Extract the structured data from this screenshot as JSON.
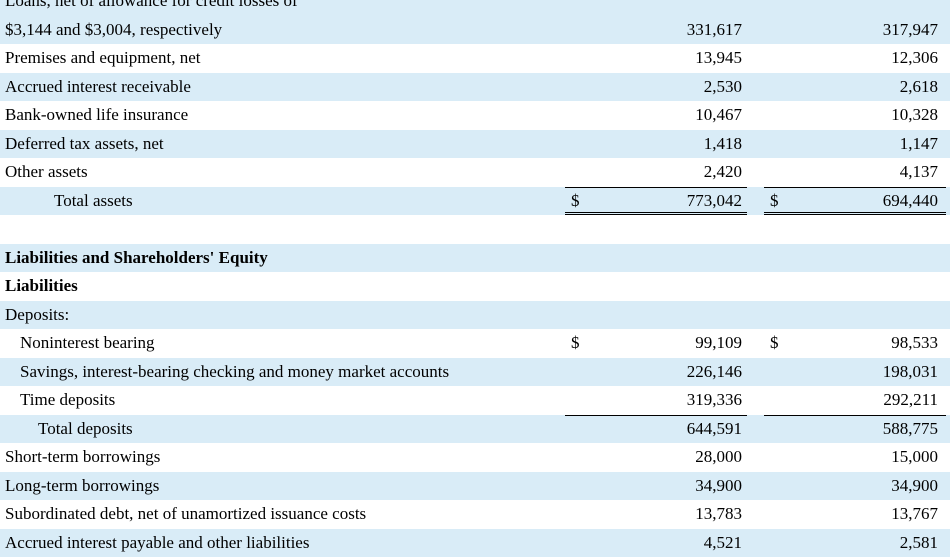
{
  "assets": {
    "loans_label_line1": "Loans, net of allowance for credit losses of",
    "loans_label_line2": "$3,144 and $3,004, respectively",
    "rows": [
      {
        "label": "Premises and equipment, net",
        "v1": "13,945",
        "v2": "12,306"
      },
      {
        "label": "Accrued interest receivable",
        "v1": "2,530",
        "v2": "2,618"
      },
      {
        "label": "Bank-owned life insurance",
        "v1": "10,467",
        "v2": "10,328"
      },
      {
        "label": "Deferred tax assets, net",
        "v1": "1,418",
        "v2": "1,147"
      },
      {
        "label": "Other assets",
        "v1": "2,420",
        "v2": "4,137"
      }
    ],
    "loans_v1": "331,617",
    "loans_v2": "317,947",
    "total_label": "Total assets",
    "total_cur": "$",
    "total_v1": "773,042",
    "total_v2": "694,440"
  },
  "liabilities": {
    "section_title": "Liabilities and Shareholders' Equity",
    "subtitle": "Liabilities",
    "deposits_label": "Deposits:",
    "noninterest_label": "Noninterest bearing",
    "noninterest_cur": "$",
    "noninterest_v1": "99,109",
    "noninterest_v2": "98,533",
    "savings_label": "Savings, interest-bearing checking and money market accounts",
    "savings_v1": "226,146",
    "savings_v2": "198,031",
    "time_label": "Time deposits",
    "time_v1": "319,336",
    "time_v2": "292,211",
    "total_deposits_label": "Total deposits",
    "total_deposits_v1": "644,591",
    "total_deposits_v2": "588,775",
    "short_label": "Short-term borrowings",
    "short_v1": "28,000",
    "short_v2": "15,000",
    "long_label": "Long-term borrowings",
    "long_v1": "34,900",
    "long_v2": "34,900",
    "sub_label": "Subordinated debt, net of unamortized issuance costs",
    "sub_v1": "13,783",
    "sub_v2": "13,767",
    "accrued_label": "Accrued interest payable and other liabilities",
    "accrued_v1": "4,521",
    "accrued_v2": "2,581"
  }
}
